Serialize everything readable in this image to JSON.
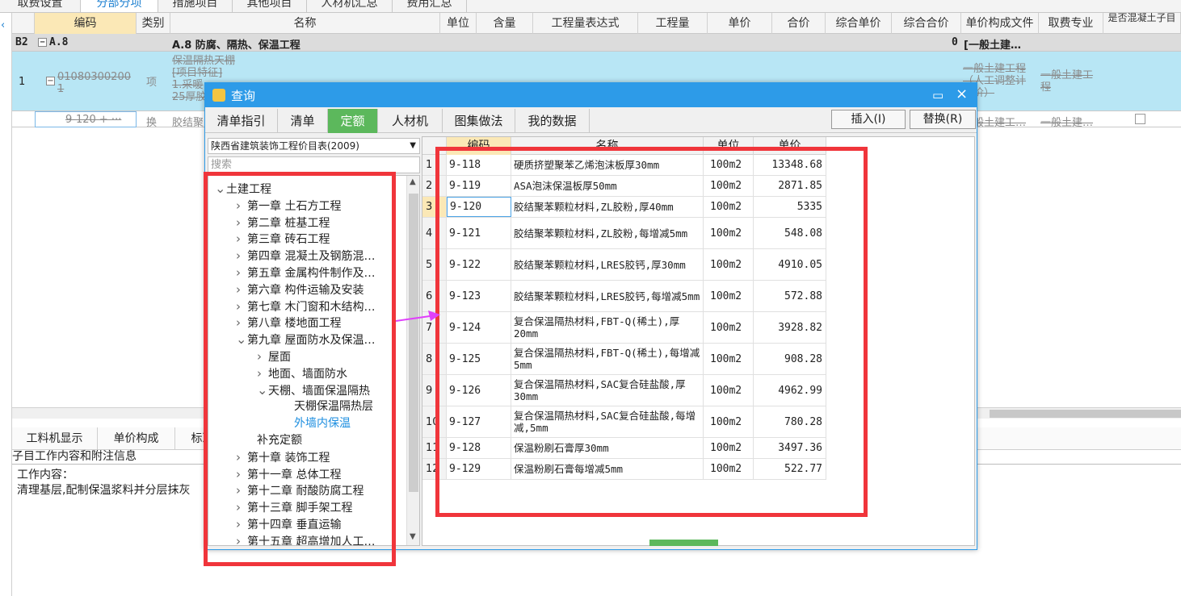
{
  "top_tabs": [
    "取费设置",
    "分部分项",
    "措施项目",
    "其他项目",
    "人材机汇总",
    "费用汇总"
  ],
  "top_active": 1,
  "columns": [
    "编码",
    "类别",
    "名称",
    "单位",
    "含量",
    "工程量表达式",
    "工程量",
    "单价",
    "合价",
    "综合单价",
    "综合合价",
    "单价构成文件",
    "取费专业",
    "是否混凝土子目"
  ],
  "row_b2": {
    "idx": "B2",
    "code": "A.8",
    "name": "A.8  防腐、隔热、保温工程",
    "zhhj": "0",
    "gcwj": "[一般土建…"
  },
  "row_item": {
    "idx": "1",
    "code_line1": "01080300200",
    "code_line2": "1",
    "type": "项",
    "name_lines": [
      "保温隔热天棚",
      "[项目特征]",
      "1.采暖",
      "25厚胶"
    ],
    "gcwj_lines": [
      "一般土建工程",
      "（人工调整计",
      "差价）"
    ],
    "qfzy": "一般土建工程"
  },
  "row_sub": {
    "code": "9-120  + ···",
    "type": "换",
    "name": "胶结聚",
    "gcwj": "一般土建工…",
    "qfzy": "一般土建…"
  },
  "bottom_tabs": [
    "工料机显示",
    "单价构成",
    "标准换算"
  ],
  "sub_info_label": "子目工作内容和附注信息",
  "work_title": "工作内容：",
  "work_text": "清理基层,配制保温浆料并分层抹灰",
  "dialog": {
    "title": "查询",
    "tabs": [
      "清单指引",
      "清单",
      "定额",
      "人材机",
      "图集做法",
      "我的数据"
    ],
    "active_tab": 2,
    "insert_btn": "插入(I)",
    "replace_btn": "替换(R)",
    "library": "陕西省建筑装饰工程价目表(2009)",
    "search_placeholder": "搜索",
    "tree": [
      {
        "label": "土建工程",
        "level": 0,
        "icon": "chevron-down"
      },
      {
        "label": "第一章  土石方工程",
        "level": 1,
        "icon": "chevron-right"
      },
      {
        "label": "第二章  桩基工程",
        "level": 1,
        "icon": "chevron-right"
      },
      {
        "label": "第三章  砖石工程",
        "level": 1,
        "icon": "chevron-right"
      },
      {
        "label": "第四章  混凝土及钢筋混…",
        "level": 1,
        "icon": "chevron-right"
      },
      {
        "label": "第五章  金属构件制作及…",
        "level": 1,
        "icon": "chevron-right"
      },
      {
        "label": "第六章  构件运输及安装",
        "level": 1,
        "icon": "chevron-right"
      },
      {
        "label": "第七章  木门窗和木结构…",
        "level": 1,
        "icon": "chevron-right"
      },
      {
        "label": "第八章  楼地面工程",
        "level": 1,
        "icon": "chevron-right"
      },
      {
        "label": "第九章  屋面防水及保温…",
        "level": 1,
        "icon": "chevron-down"
      },
      {
        "label": "屋面",
        "level": 2,
        "icon": "chevron-right"
      },
      {
        "label": "地面、墙面防水",
        "level": 2,
        "icon": "chevron-right"
      },
      {
        "label": "天棚、墙面保温隔热",
        "level": 2,
        "icon": "chevron-down"
      },
      {
        "label": "天棚保温隔热层",
        "level": 3,
        "icon": ""
      },
      {
        "label": "外墙内保温",
        "level": 3,
        "icon": "",
        "selected": true
      },
      {
        "label": "补充定额",
        "level": 2,
        "icon": ""
      },
      {
        "label": "第十章  装饰工程",
        "level": 1,
        "icon": "chevron-right"
      },
      {
        "label": "第十一章  总体工程",
        "level": 1,
        "icon": "chevron-right"
      },
      {
        "label": "第十二章  耐酸防腐工程",
        "level": 1,
        "icon": "chevron-right"
      },
      {
        "label": "第十三章  脚手架工程",
        "level": 1,
        "icon": "chevron-right"
      },
      {
        "label": "第十四章  垂直运输",
        "level": 1,
        "icon": "chevron-right"
      },
      {
        "label": "第十五章  超高增加人工…",
        "level": 1,
        "icon": "chevron-right"
      }
    ],
    "table_headers": [
      "",
      "编码",
      "名称",
      "单位",
      "单价"
    ],
    "rows": [
      {
        "num": "1",
        "code": "9-118",
        "name": "硬质挤塑聚苯乙烯泡沫板厚30mm",
        "unit": "100m2",
        "price": "13348.68"
      },
      {
        "num": "2",
        "code": "9-119",
        "name": "ASA泡沫保温板厚50mm",
        "unit": "100m2",
        "price": "2871.85"
      },
      {
        "num": "3",
        "code": "9-120",
        "name": "胶结聚苯颗粒材料,ZL胶粉,厚40mm",
        "unit": "100m2",
        "price": "5335",
        "current": true
      },
      {
        "num": "4",
        "code": "9-121",
        "name": "胶结聚苯颗粒材料,ZL胶粉,每增减5mm",
        "unit": "100m2",
        "price": "548.08"
      },
      {
        "num": "5",
        "code": "9-122",
        "name": "胶结聚苯颗粒材料,LRES胶钙,厚30mm",
        "unit": "100m2",
        "price": "4910.05"
      },
      {
        "num": "6",
        "code": "9-123",
        "name": "胶结聚苯颗粒材料,LRES胶钙,每增减5mm",
        "unit": "100m2",
        "price": "572.88"
      },
      {
        "num": "7",
        "code": "9-124",
        "name": "复合保温隔热材料,FBT-Q(稀土),厚20mm",
        "unit": "100m2",
        "price": "3928.82"
      },
      {
        "num": "8",
        "code": "9-125",
        "name": "复合保温隔热材料,FBT-Q(稀土),每增减5mm",
        "unit": "100m2",
        "price": "908.28"
      },
      {
        "num": "9",
        "code": "9-126",
        "name": "复合保温隔热材料,SAC复合硅盐酸,厚30mm",
        "unit": "100m2",
        "price": "4962.99"
      },
      {
        "num": "10",
        "code": "9-127",
        "name": "复合保温隔热材料,SAC复合硅盐酸,每增减,5mm",
        "unit": "100m2",
        "price": "780.28"
      },
      {
        "num": "11",
        "code": "9-128",
        "name": "保温粉刷石膏厚30mm",
        "unit": "100m2",
        "price": "3497.36"
      },
      {
        "num": "12",
        "code": "9-129",
        "name": "保温粉刷石膏每增减5mm",
        "unit": "100m2",
        "price": "522.77"
      }
    ]
  },
  "colors": {
    "accent": "#2d9be8",
    "active_tab": "#5cb85c",
    "highlight_red": "#f0353b",
    "arrow": "#e040fb",
    "selected_row": "#b8e6f5"
  }
}
